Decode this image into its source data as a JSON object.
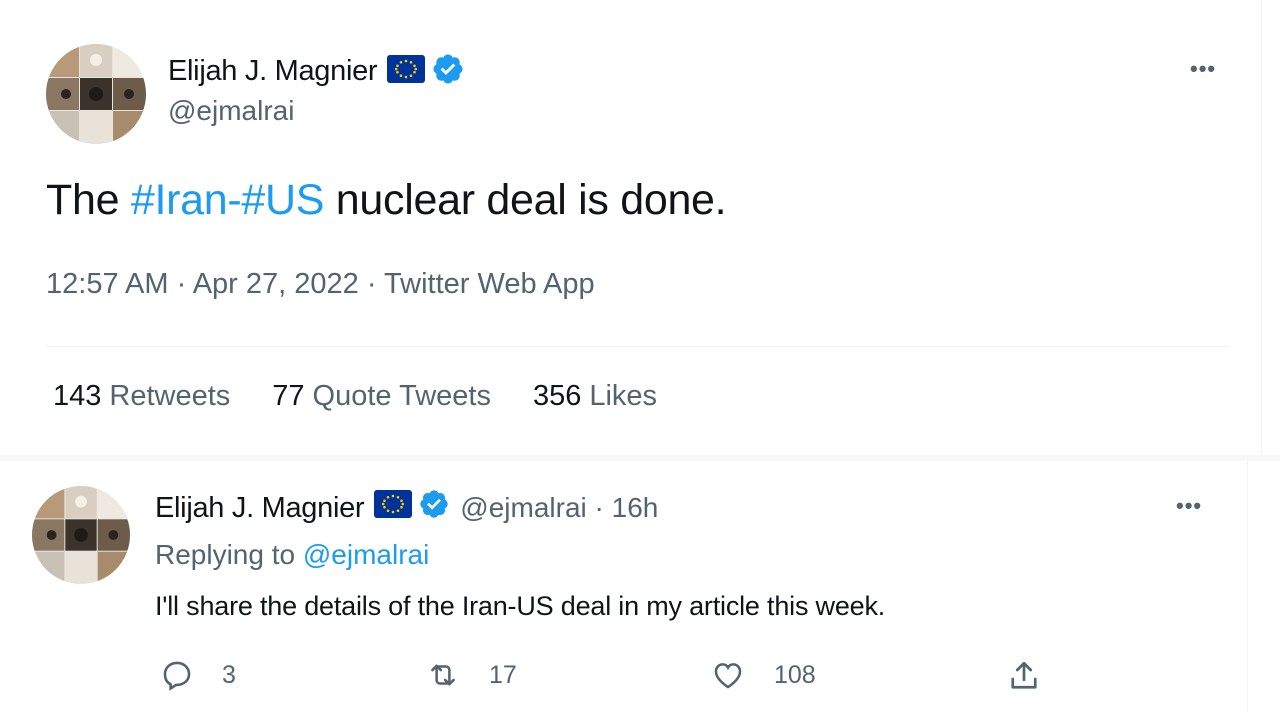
{
  "colors": {
    "accent": "#1d9bf0",
    "secondary_text": "#536471",
    "verified": "#1d9bf0",
    "eu_flag": "#003399"
  },
  "main_tweet": {
    "author_name": "Elijah J. Magnier",
    "author_handle": "@ejmalrai",
    "text_before": "The ",
    "hashtag_1": "#Iran",
    "dash": "-",
    "hashtag_2": "#US",
    "text_after": " nuclear deal is done.",
    "meta": "12:57 AM · Apr 27, 2022 · Twitter Web App",
    "retweets_count": "143",
    "retweets_label": "Retweets",
    "quotes_count": "77",
    "quotes_label": "Quote Tweets",
    "likes_count": "356",
    "likes_label": "Likes",
    "more_label": "•••"
  },
  "reply_tweet": {
    "author_name": "Elijah J. Magnier",
    "handle_time": "@ejmalrai · 16h",
    "replying_prefix": "Replying to ",
    "replying_handle": "@ejmalrai",
    "text": "I'll share the details of the Iran-US deal in my article this week.",
    "reply_count": "3",
    "retweet_count": "17",
    "like_count": "108",
    "more_label": "•••"
  },
  "icons": [
    "eu-flag-icon",
    "verified-icon",
    "more-icon",
    "reply-icon",
    "retweet-icon",
    "like-icon",
    "share-icon"
  ]
}
